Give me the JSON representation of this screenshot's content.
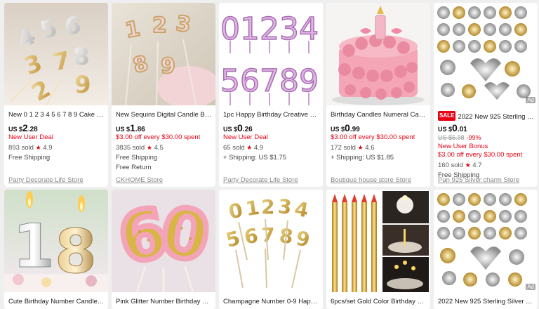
{
  "products": [
    {
      "title": "New 0 1 2 3 4 5 6 7 8 9 Cake Toppe...",
      "currency": "US $",
      "price_int": "2",
      "price_dec": ".28",
      "promo": "New User Deal",
      "sold": "893 sold",
      "rating": "4.9",
      "ship1": "Free Shipping",
      "ship2": "",
      "store": "Party Decorate Life Store"
    },
    {
      "title": "New Sequins Digital Candle Birthd...",
      "currency": "US $",
      "price_int": "1",
      "price_dec": ".86",
      "promo": "$3.00 off every $30.00 spent",
      "sold": "3835 sold",
      "rating": "4.5",
      "ship1": "Free Shipping",
      "ship2": "Free Return",
      "store": "CKHOME Store"
    },
    {
      "title": "1pc Happy Birthday Creative 0-9 N...",
      "currency": "US $",
      "price_int": "0",
      "price_dec": ".26",
      "promo": "New User Deal",
      "sold": "65 sold",
      "rating": "4.9",
      "ship1": "+ Shipping: US $1.75",
      "ship2": "",
      "store": "Party Decorate Life Store"
    },
    {
      "title": "Birthday Candles Numeral Candles...",
      "currency": "US $",
      "price_int": "0",
      "price_dec": ".99",
      "promo": "$3.00 off every $30.00 spent",
      "sold": "172 sold",
      "rating": "4.6",
      "ship1": "+ Shipping: US $1.85",
      "ship2": "",
      "store": "Boutique house store Store"
    },
    {
      "sale": "SALE",
      "title": "2022 New 925 Sterling Silv...",
      "currency": "US $",
      "price_int": "0",
      "price_dec": ".01",
      "orig": "US $5.98",
      "discount": "-99%",
      "promo": "New User Bonus",
      "promo2": "$3.00 off every $30.00 spent",
      "sold": "160 sold",
      "rating": "4.7",
      "ship1": "Free Shipping",
      "store": "Pan 925 Silver charm Store",
      "ad": "Ad"
    }
  ],
  "products2": [
    {
      "title": "Cute Birthday Number Candle Silv..."
    },
    {
      "title": "Pink Glitter Number Birthday Cand..."
    },
    {
      "title": "Champagne Number 0-9 Happy Bi..."
    },
    {
      "title": "6pcs/set Gold Color Birthday Cand..."
    },
    {
      "title": "2022 New 925 Sterling Silver circul...",
      "ad": "Ad"
    }
  ],
  "star_glyph": "★",
  "colors": {
    "accent": "#e60012",
    "muted": "#888888"
  }
}
